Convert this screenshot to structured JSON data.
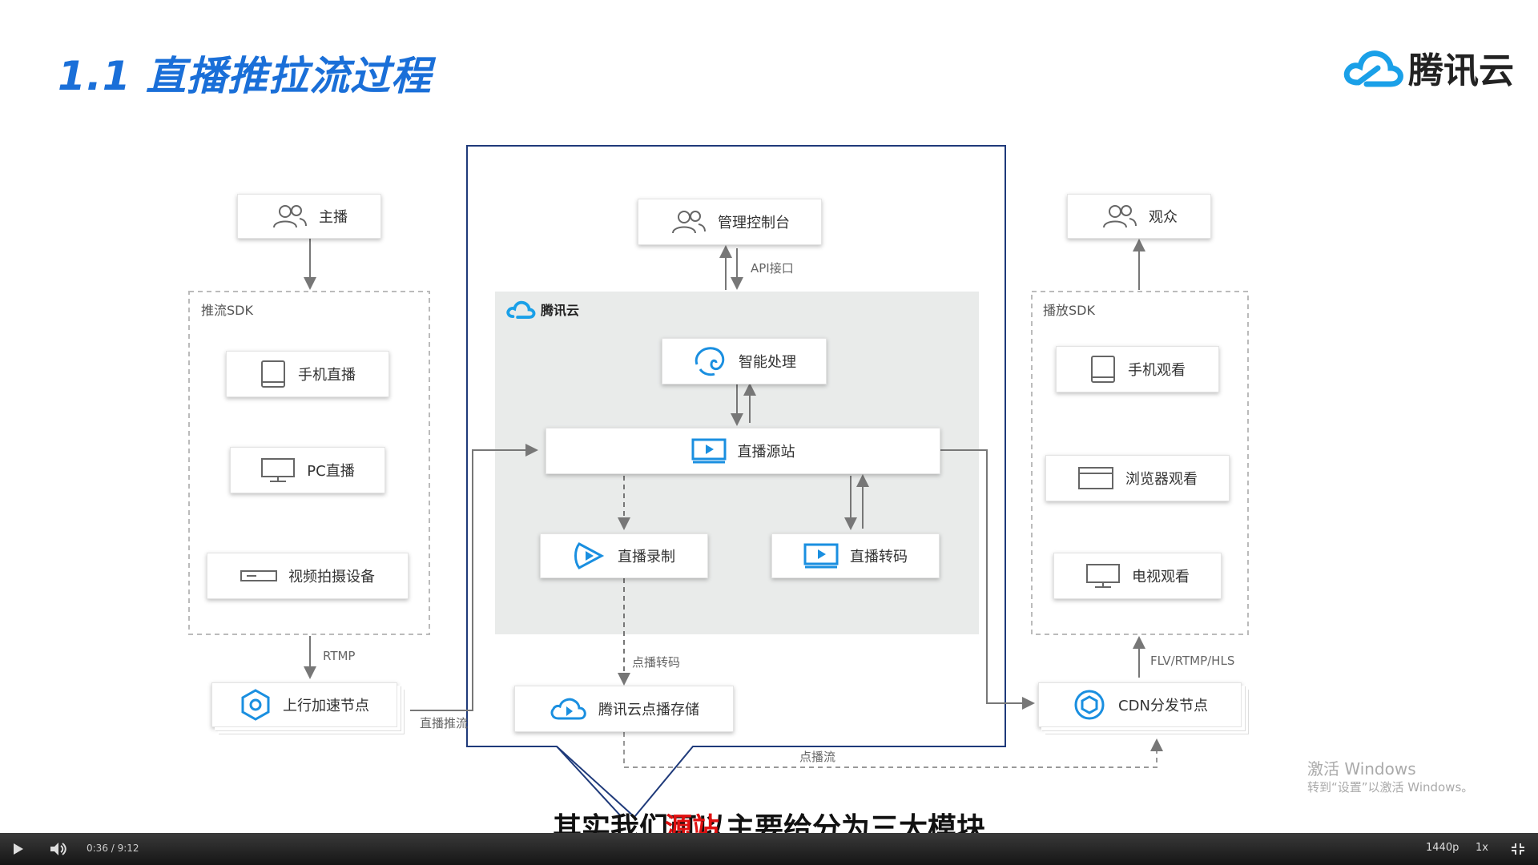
{
  "slide": {
    "title": "1.1 直播推拉流过程",
    "brand": "腾讯云"
  },
  "left": {
    "anchor": "主播",
    "sdk_label": "推流SDK",
    "items": [
      "手机直播",
      "PC直播",
      "视频拍摄设备"
    ],
    "protocol": "RTMP",
    "uplink_node": "上行加速节点",
    "push_label": "直播推流"
  },
  "center": {
    "console": "管理控制台",
    "api": "API接口",
    "cloud_label": "腾讯云",
    "ai": "智能处理",
    "origin": "直播源站",
    "record": "直播录制",
    "transcode": "直播转码",
    "vod_transcode": "点播转码",
    "vod_storage": "腾讯云点播存储",
    "vod_stream": "点播流"
  },
  "right": {
    "audience": "观众",
    "sdk_label": "播放SDK",
    "items": [
      "手机观看",
      "浏览器观看",
      "电视观看"
    ],
    "protocols": "FLV/RTMP/HLS",
    "cdn_node": "CDN分发节点"
  },
  "subtitle": {
    "before": "其实我们",
    "overlay": "源站",
    "mid": "可",
    "after": "以主要给分为三大模块"
  },
  "watermark": {
    "line1": "激活 Windows",
    "line2": "转到“设置”以激活 Windows。"
  },
  "player": {
    "time": "0:36 / 9:12",
    "quality": "1440p",
    "speed": "1x",
    "progress": 0.0652
  },
  "colors": {
    "accent": "#1a6fd8",
    "brand_blue": "#1aa0e8",
    "icon_blue": "#1a8fe0",
    "panel_gray": "#e9ebea",
    "frame_navy": "#1f3a7a",
    "subtitle_red": "#e01010",
    "progress": "#4aa3f0"
  }
}
